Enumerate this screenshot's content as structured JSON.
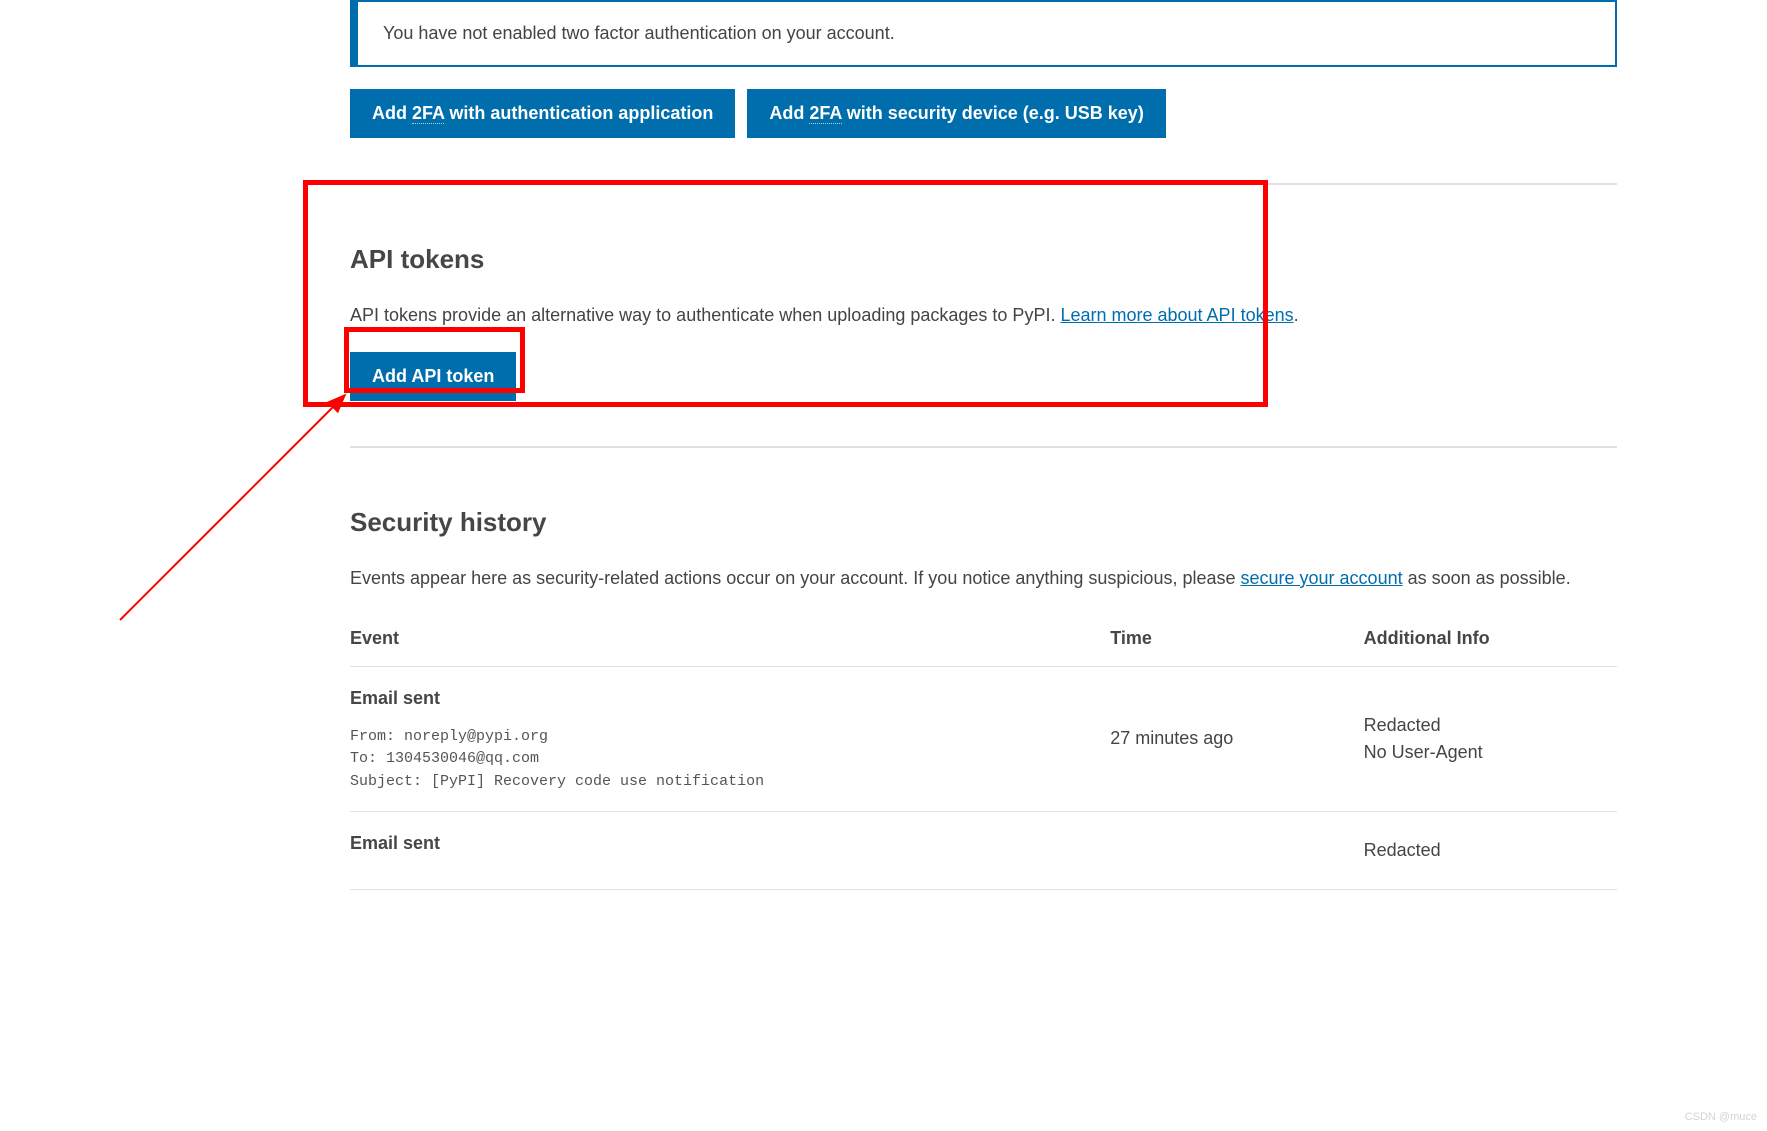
{
  "twofa": {
    "callout_text": "You have not enabled two factor authentication on your account.",
    "btn_app_pre": "Add ",
    "btn_app_abbr": "2FA",
    "btn_app_post": " with authentication application",
    "btn_device_pre": "Add ",
    "btn_device_abbr": "2FA",
    "btn_device_post": " with security device (e.g. USB key)"
  },
  "api_tokens": {
    "heading": "API tokens",
    "description_pre": "API tokens provide an alternative way to authenticate when uploading packages to PyPI. ",
    "learn_more": "Learn more about API tokens",
    "description_post": ".",
    "add_btn": "Add API token"
  },
  "security_history": {
    "heading": "Security history",
    "description_pre": "Events appear here as security-related actions occur on your account. If you notice anything suspicious, please ",
    "secure_link": "secure your account",
    "description_post": " as soon as possible.",
    "col_event": "Event",
    "col_time": "Time",
    "col_info": "Additional Info",
    "events": [
      {
        "title": "Email sent",
        "from_label": "From: ",
        "from_value": "noreply@pypi.org",
        "to_label": "To: ",
        "to_value": "1304530046@qq.com",
        "subject_label": "Subject: ",
        "subject_value": "[PyPI] Recovery code use notification",
        "time": "27 minutes ago",
        "info_line1": "Redacted",
        "info_line2": "No User-Agent"
      },
      {
        "title": "Email sent",
        "info_line1": "Redacted"
      }
    ]
  },
  "watermark": "CSDN @muce"
}
